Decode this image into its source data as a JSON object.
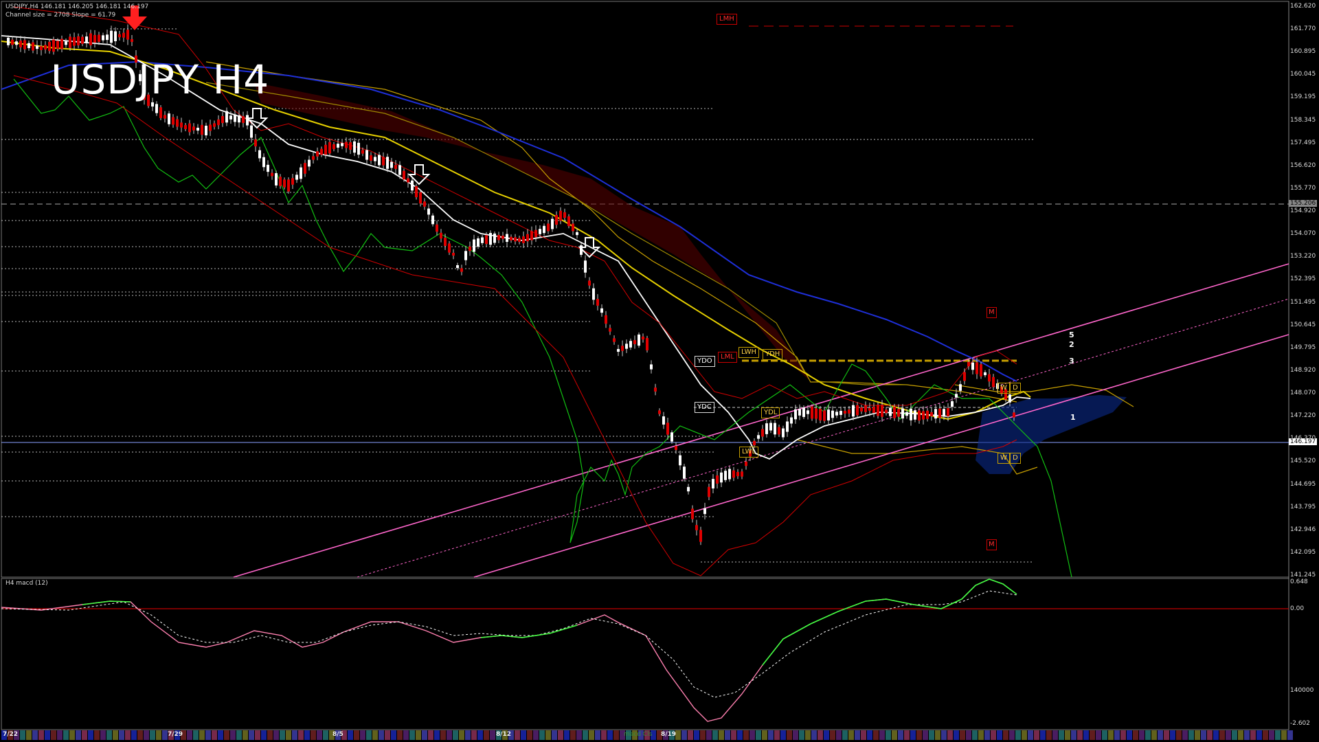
{
  "header": {
    "symbol_line": "USDJPY,H4  146.181 146.205 146.181 146.197",
    "channel_line": "Channel size = 2708 Slope = 61.79",
    "big_title": "USDJPY H4"
  },
  "price_axis": {
    "labels": [
      "162.620",
      "161.770",
      "160.895",
      "160.045",
      "159.195",
      "158.345",
      "157.495",
      "156.620",
      "155.770",
      "154.920",
      "154.070",
      "153.220",
      "152.395",
      "151.495",
      "150.645",
      "149.795",
      "148.920",
      "148.070",
      "147.220",
      "146.370",
      "145.520",
      "144.695",
      "143.795",
      "142.946",
      "142.095",
      "141.245"
    ],
    "dash_level_flag": "155.206",
    "current_price_flag": "146.197"
  },
  "macd_axis": {
    "labels": [
      "0.648",
      "0.00",
      "140000",
      "-2.602"
    ]
  },
  "macd_pane": {
    "label": "H4 macd (12)"
  },
  "time_axis": {
    "labels": [
      "7/22",
      "7/29",
      "8/5",
      "8/12",
      "8/19"
    ],
    "marker_text": "macd Cls"
  },
  "chart_boxes": {
    "lmh": "LMH",
    "ydo": "YDO",
    "lml": "LML",
    "lwh": "LWH",
    "ydh": "YDH",
    "ydc": "YDC",
    "ydl": "YDL",
    "lwl": "LWL",
    "w": "W",
    "d": "D",
    "m": "M"
  },
  "channel_numbers": [
    "5",
    "2",
    "3",
    "1"
  ],
  "colors": {
    "background": "#000000",
    "ma_blue": "#1e2fd8",
    "ma_yellow": "#e6d000",
    "ma_white": "#ffffff",
    "green": "#12c012",
    "magenta": "#ff66cc",
    "red": "#d40000",
    "gold": "#c8a000"
  }
}
